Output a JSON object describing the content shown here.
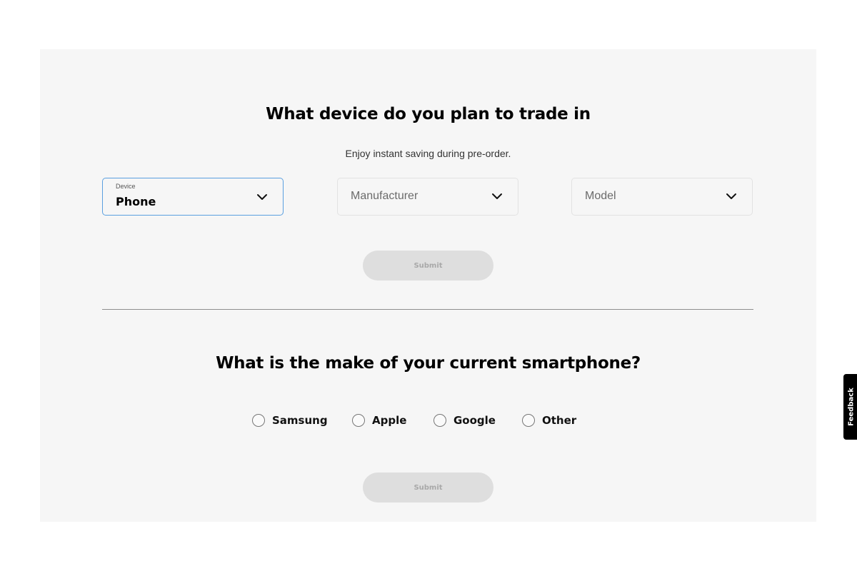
{
  "section_device": {
    "title": "What device do you plan to trade in",
    "subtitle": "Enjoy instant saving during pre-order.",
    "device_select": {
      "label": "Device",
      "value": "Phone",
      "icon": "chevron-down-icon"
    },
    "manufacturer_select": {
      "placeholder": "Manufacturer",
      "icon": "chevron-down-icon"
    },
    "model_select": {
      "placeholder": "Model",
      "icon": "chevron-down-icon"
    },
    "submit_label": "Submit",
    "submit_disabled": true
  },
  "section_make": {
    "title": "What is the make of your current smartphone?",
    "options": [
      {
        "label": "Samsung",
        "selected": false
      },
      {
        "label": "Apple",
        "selected": false
      },
      {
        "label": "Google",
        "selected": false
      },
      {
        "label": "Other",
        "selected": false
      }
    ],
    "submit_label": "Submit",
    "submit_disabled": true
  },
  "feedback_tab": {
    "label": "Feedback"
  },
  "colors": {
    "panel_bg": "#f6f6f6",
    "active_border": "#5a9fe0",
    "button_disabled_bg": "#dedede",
    "button_disabled_text": "#a8a8a8",
    "feedback_bg": "#000000"
  }
}
